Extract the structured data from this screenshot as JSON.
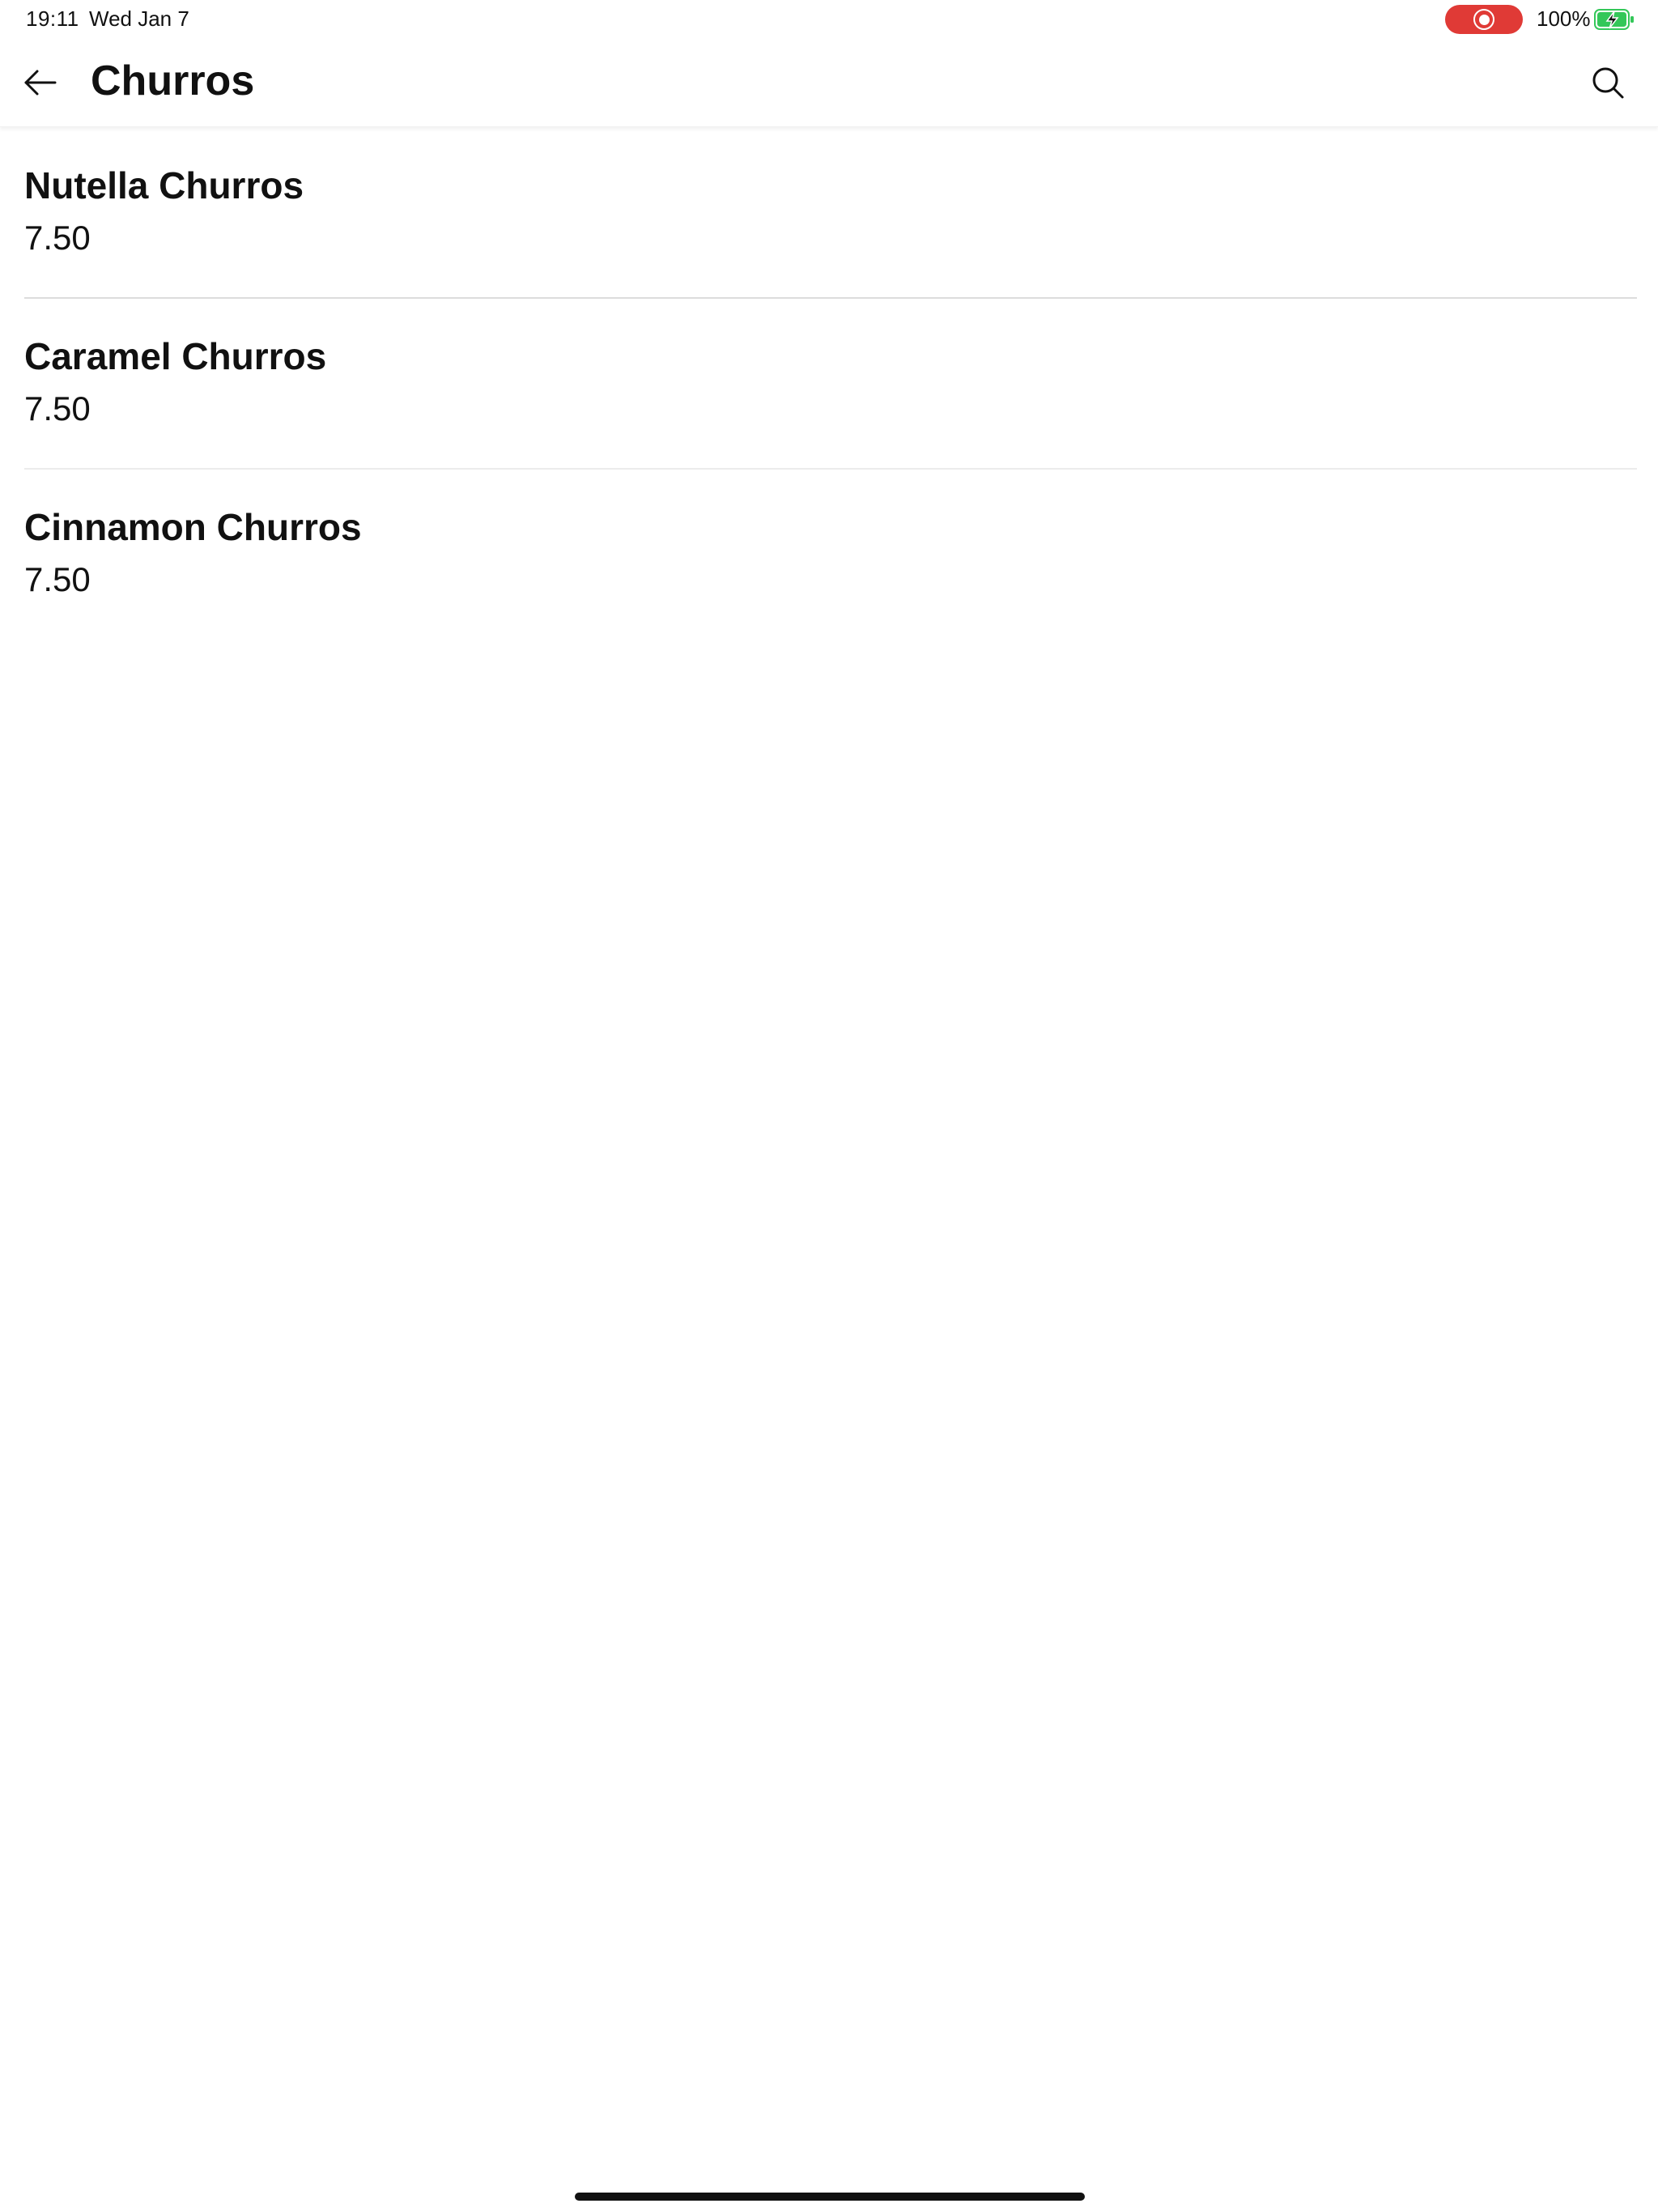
{
  "status_bar": {
    "time": "19:11",
    "date": "Wed Jan 7",
    "battery_percent": "100%",
    "record_color": "#e03a36",
    "battery_color": "#34c759",
    "battery_icon": "battery-charging-icon",
    "record_icon": "screen-record-icon"
  },
  "header": {
    "title": "Churros",
    "back_icon": "arrow-left-icon",
    "search_icon": "search-icon"
  },
  "menu": {
    "items": [
      {
        "name": "Nutella Churros",
        "price": "7.50"
      },
      {
        "name": "Caramel Churros",
        "price": "7.50"
      },
      {
        "name": "Cinnamon Churros",
        "price": "7.50"
      }
    ]
  }
}
